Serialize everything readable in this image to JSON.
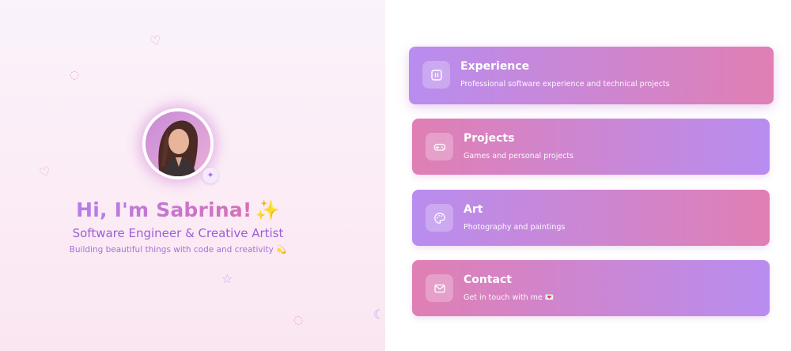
{
  "hero": {
    "title": "Hi, I'm Sabrina!",
    "title_emoji": "✨",
    "subtitle": "Software Engineer & Creative Artist",
    "tagline": "Building beautiful things with code and creativity 💫",
    "avatar_badge_icon": "sparkles-icon"
  },
  "decorations": [
    "♡",
    "♡",
    "♡",
    "☆",
    "☾"
  ],
  "cards": [
    {
      "title": "Experience",
      "description": "Professional software experience and technical projects",
      "icon": "code-icon",
      "gradient": [
        "#b88df0",
        "#e07fb4"
      ]
    },
    {
      "title": "Projects",
      "description": "Games and personal projects",
      "icon": "gamepad-icon",
      "gradient": [
        "#e07fb4",
        "#b88df0"
      ]
    },
    {
      "title": "Art",
      "description": "Photography and paintings",
      "icon": "palette-icon",
      "gradient": [
        "#b88df0",
        "#e07fb4"
      ]
    },
    {
      "title": "Contact",
      "description": "Get in touch with me 💌",
      "icon": "mail-icon",
      "gradient": [
        "#e07fb4",
        "#b88df0"
      ]
    }
  ],
  "colors": {
    "accent_purple": "#b88df0",
    "accent_pink": "#e07fb4",
    "text_purple": "#9b5fd6"
  }
}
